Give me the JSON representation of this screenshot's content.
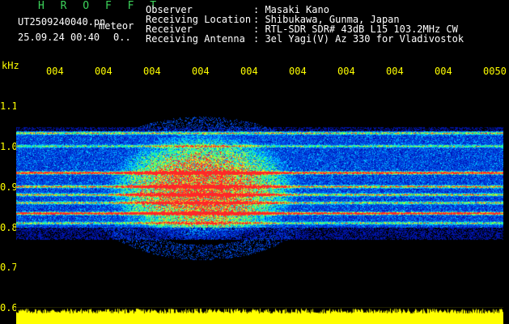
{
  "app": {
    "title": "H R O F F T",
    "filename": "UT2509240040.pn",
    "mode_label": "meteor",
    "datetime": "25.09.24 00:40",
    "count": "0.."
  },
  "info": [
    {
      "label": "Observer",
      "value": ": Masaki Kano"
    },
    {
      "label": "Receiving Location",
      "value": ": Shibukawa, Gunma, Japan"
    },
    {
      "label": "Receiver",
      "value": ": RTL-SDR SDR# 43dB L15 103.2MHz CW"
    },
    {
      "label": "Receiving Antenna",
      "value": ": 3el Yagi(V) Az 330 for Vladivostok"
    }
  ],
  "axis": {
    "unit": "kHz",
    "time_ticks": [
      "004",
      "004",
      "004",
      "004",
      "004",
      "004",
      "004",
      "004",
      "004",
      "0050"
    ],
    "freq_ticks": [
      "1.1",
      "1.0",
      "0.9",
      "0.8",
      "0.7",
      "0.6"
    ]
  },
  "colors": {
    "background": "#000000",
    "text_green": "#3cd35a",
    "text_yellow": "#ffff00",
    "signal_low": "#0018a0",
    "signal_mid": "#00e0ff",
    "signal_high": "#ff2020",
    "baseline": "#ffff00"
  }
}
